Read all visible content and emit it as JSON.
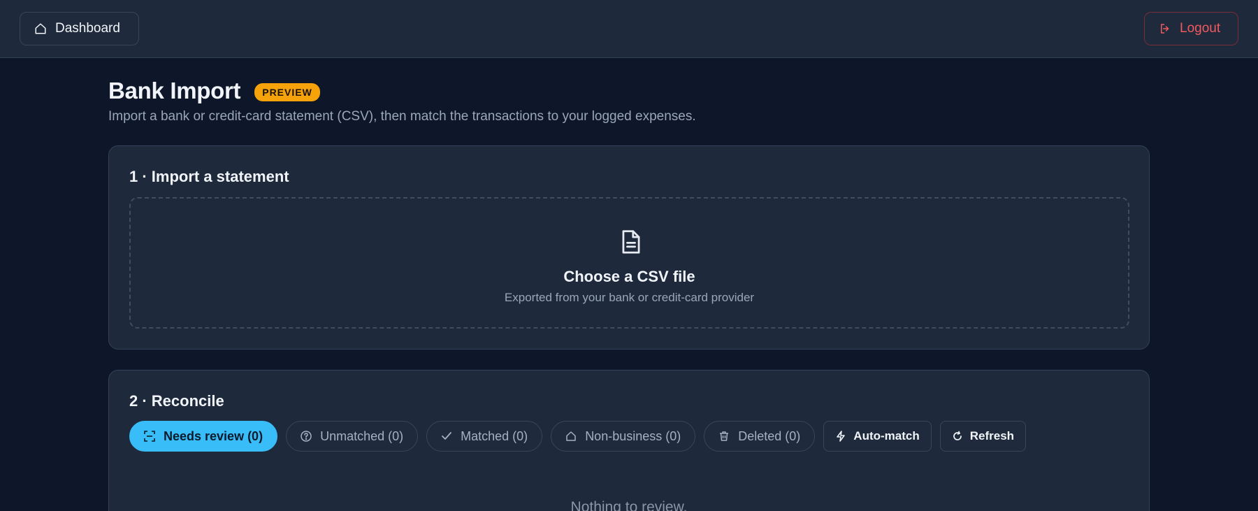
{
  "topbar": {
    "dashboard_label": "Dashboard",
    "dashboard_icon": "home-icon",
    "logout_label": "Logout",
    "logout_icon": "logout-icon"
  },
  "header": {
    "title": "Bank Import",
    "badge": "PREVIEW",
    "subtitle": "Import a bank or credit-card statement (CSV), then match the transactions to your logged expenses."
  },
  "import_card": {
    "title": "1 · Import a statement",
    "dropzone": {
      "icon": "file-icon",
      "title": "Choose a CSV file",
      "subtitle": "Exported from your bank or credit-card provider"
    }
  },
  "reconcile_card": {
    "title": "2 · Reconcile",
    "filters": [
      {
        "label": "Needs review (0)",
        "icon": "review-icon",
        "active": true
      },
      {
        "label": "Unmatched (0)",
        "icon": "question-icon",
        "active": false
      },
      {
        "label": "Matched (0)",
        "icon": "check-icon",
        "active": false
      },
      {
        "label": "Non-business (0)",
        "icon": "home-icon",
        "active": false
      },
      {
        "label": "Deleted (0)",
        "icon": "trash-icon",
        "active": false
      }
    ],
    "actions": [
      {
        "label": "Auto-match",
        "icon": "bolt-icon"
      },
      {
        "label": "Refresh",
        "icon": "refresh-icon"
      }
    ],
    "empty_message": "Nothing to review."
  },
  "colors": {
    "background": "#0e1629",
    "surface": "#1e293b",
    "accent": "#38bdf8",
    "badge": "#f5a20b",
    "danger": "#f05a5f"
  }
}
